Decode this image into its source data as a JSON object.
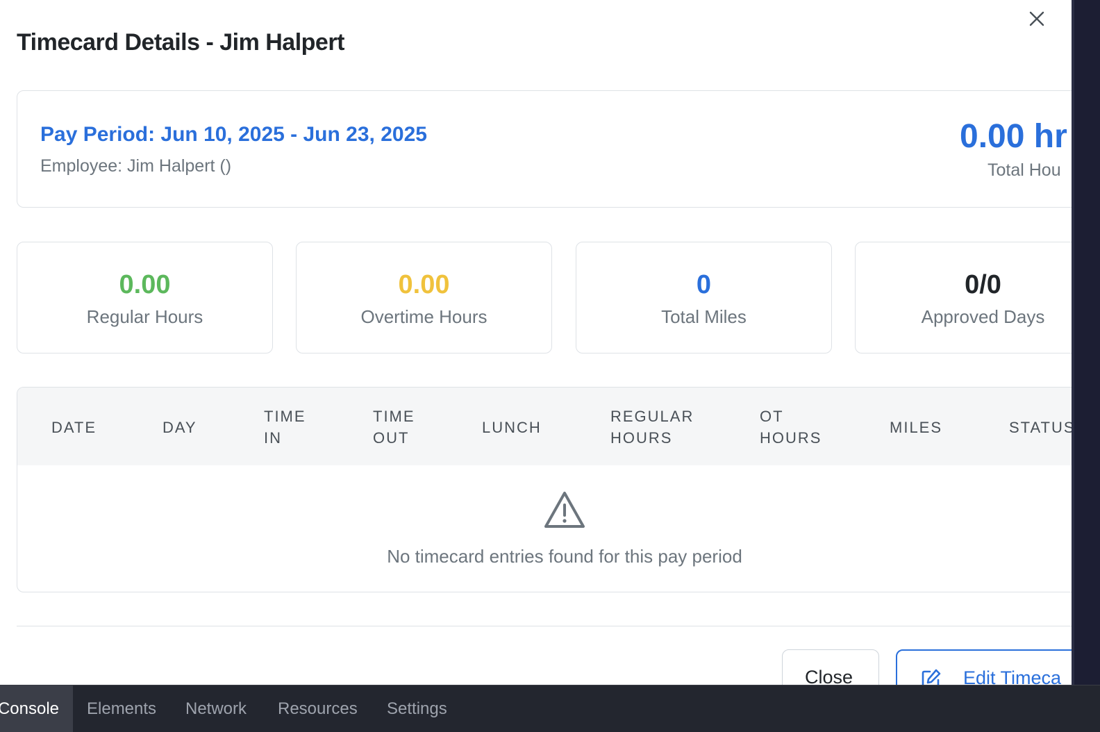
{
  "modal": {
    "title": "Timecard Details - Jim Halpert"
  },
  "summary": {
    "pay_period": "Pay Period: Jun 10, 2025 - Jun 23, 2025",
    "employee": "Employee: Jim Halpert ()",
    "total_hours_value": "0.00 hr",
    "total_hours_label": "Total Hou"
  },
  "stats": [
    {
      "value": "0.00",
      "label": "Regular Hours",
      "color": "#5cb85c"
    },
    {
      "value": "0.00",
      "label": "Overtime Hours",
      "color": "#f0c23c"
    },
    {
      "value": "0",
      "label": "Total Miles",
      "color": "#2a6fdb"
    },
    {
      "value": "0/0",
      "label": "Approved Days",
      "color": "#212529"
    }
  ],
  "table": {
    "columns": [
      {
        "line1": "DATE",
        "line2": ""
      },
      {
        "line1": "DAY",
        "line2": ""
      },
      {
        "line1": "TIME",
        "line2": "IN"
      },
      {
        "line1": "TIME",
        "line2": "OUT"
      },
      {
        "line1": "LUNCH",
        "line2": ""
      },
      {
        "line1": "REGULAR",
        "line2": "HOURS"
      },
      {
        "line1": "OT",
        "line2": "HOURS"
      },
      {
        "line1": "MILES",
        "line2": ""
      },
      {
        "line1": "STATUS",
        "line2": ""
      }
    ],
    "empty_icon": "warning-triangle-icon",
    "empty_message": "No timecard entries found for this pay period"
  },
  "footer": {
    "close_label": "Close",
    "edit_label": "Edit Timeca",
    "edit_icon": "edit-pencil-icon"
  },
  "devtools": {
    "tabs": [
      "Console",
      "Elements",
      "Network",
      "Resources",
      "Settings"
    ],
    "active_tab": "Console"
  },
  "colors": {
    "accent": "#2a6fdb",
    "regular": "#5cb85c",
    "overtime": "#f0c23c"
  }
}
